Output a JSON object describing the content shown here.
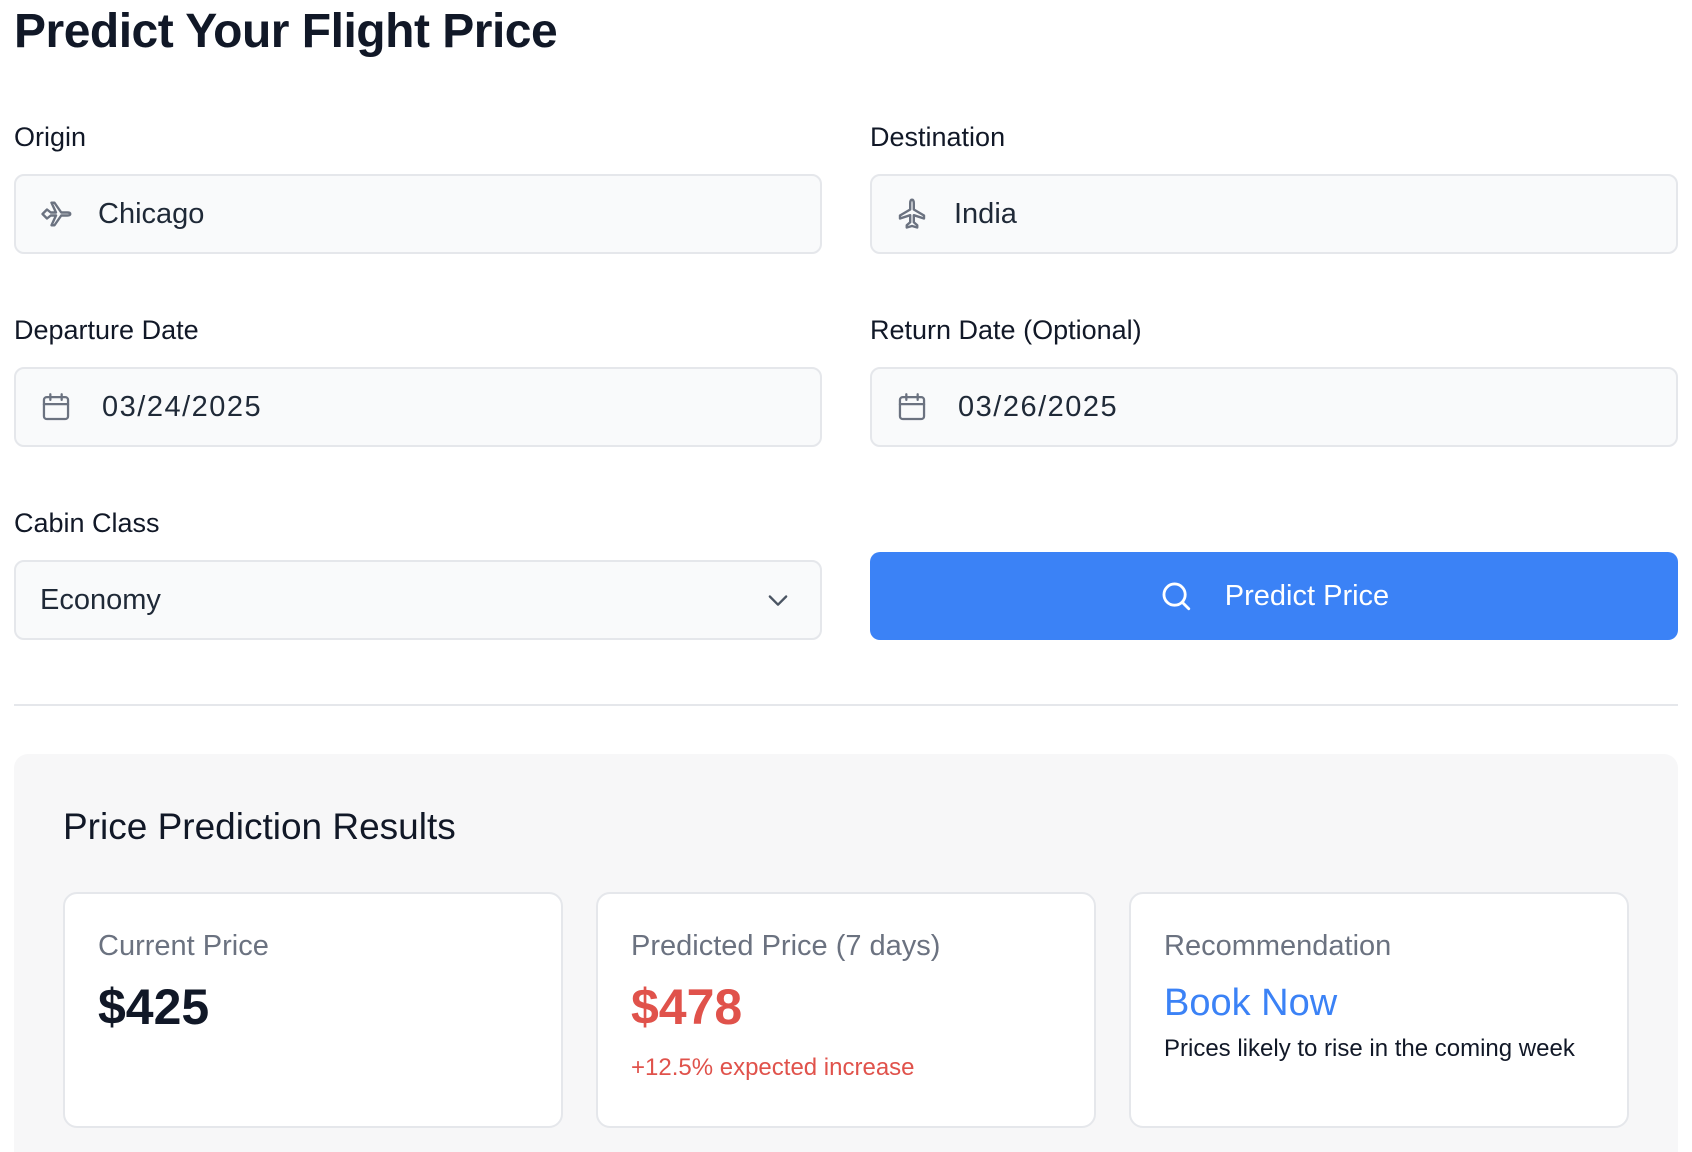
{
  "page": {
    "title": "Predict Your Flight Price"
  },
  "form": {
    "origin": {
      "label": "Origin",
      "value": "Chicago",
      "icon": "plane-takeoff-icon"
    },
    "destination": {
      "label": "Destination",
      "value": "India",
      "icon": "plane-icon"
    },
    "departure": {
      "label": "Departure Date",
      "value": "03/24/2025",
      "icon": "calendar-icon"
    },
    "return": {
      "label": "Return Date (Optional)",
      "value": "03/26/2025",
      "icon": "calendar-icon"
    },
    "cabin": {
      "label": "Cabin Class",
      "value": "Economy",
      "icon": "chevron-down-icon"
    },
    "submit": {
      "label": "Predict Price",
      "icon": "search-icon"
    }
  },
  "results": {
    "title": "Price Prediction Results",
    "current": {
      "label": "Current Price",
      "value": "$425"
    },
    "predicted": {
      "label": "Predicted Price (7 days)",
      "value": "$478",
      "change": "+12.5% expected increase"
    },
    "recommendation": {
      "label": "Recommendation",
      "value": "Book Now",
      "note": "Prices likely to rise in the coming week"
    }
  },
  "colors": {
    "accent": "#3b82f6",
    "increase": "#e0524b",
    "text": "#111827",
    "muted": "#6b7280"
  }
}
